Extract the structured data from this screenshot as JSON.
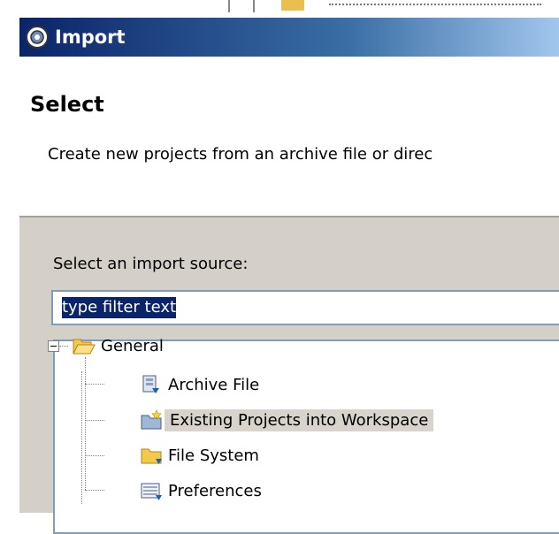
{
  "dialog": {
    "title": "Import",
    "banner_title": "Select",
    "banner_description": "Create new projects from an archive file or direc"
  },
  "source": {
    "label": "Select an import source:",
    "filter_value": "type filter text"
  },
  "tree": {
    "items": [
      {
        "label": "General",
        "icon": "folder-open-icon",
        "expanded": true
      },
      {
        "label": "Archive File",
        "icon": "archive-file-icon"
      },
      {
        "label": "Existing Projects into Workspace",
        "icon": "existing-projects-icon",
        "selected": true
      },
      {
        "label": "File System",
        "icon": "folder-icon"
      },
      {
        "label": "Preferences",
        "icon": "preferences-icon"
      }
    ]
  },
  "colors": {
    "titlebar": "#0a246a",
    "dialog_bg": "#d4d0c8",
    "selection": "#0a246a"
  }
}
